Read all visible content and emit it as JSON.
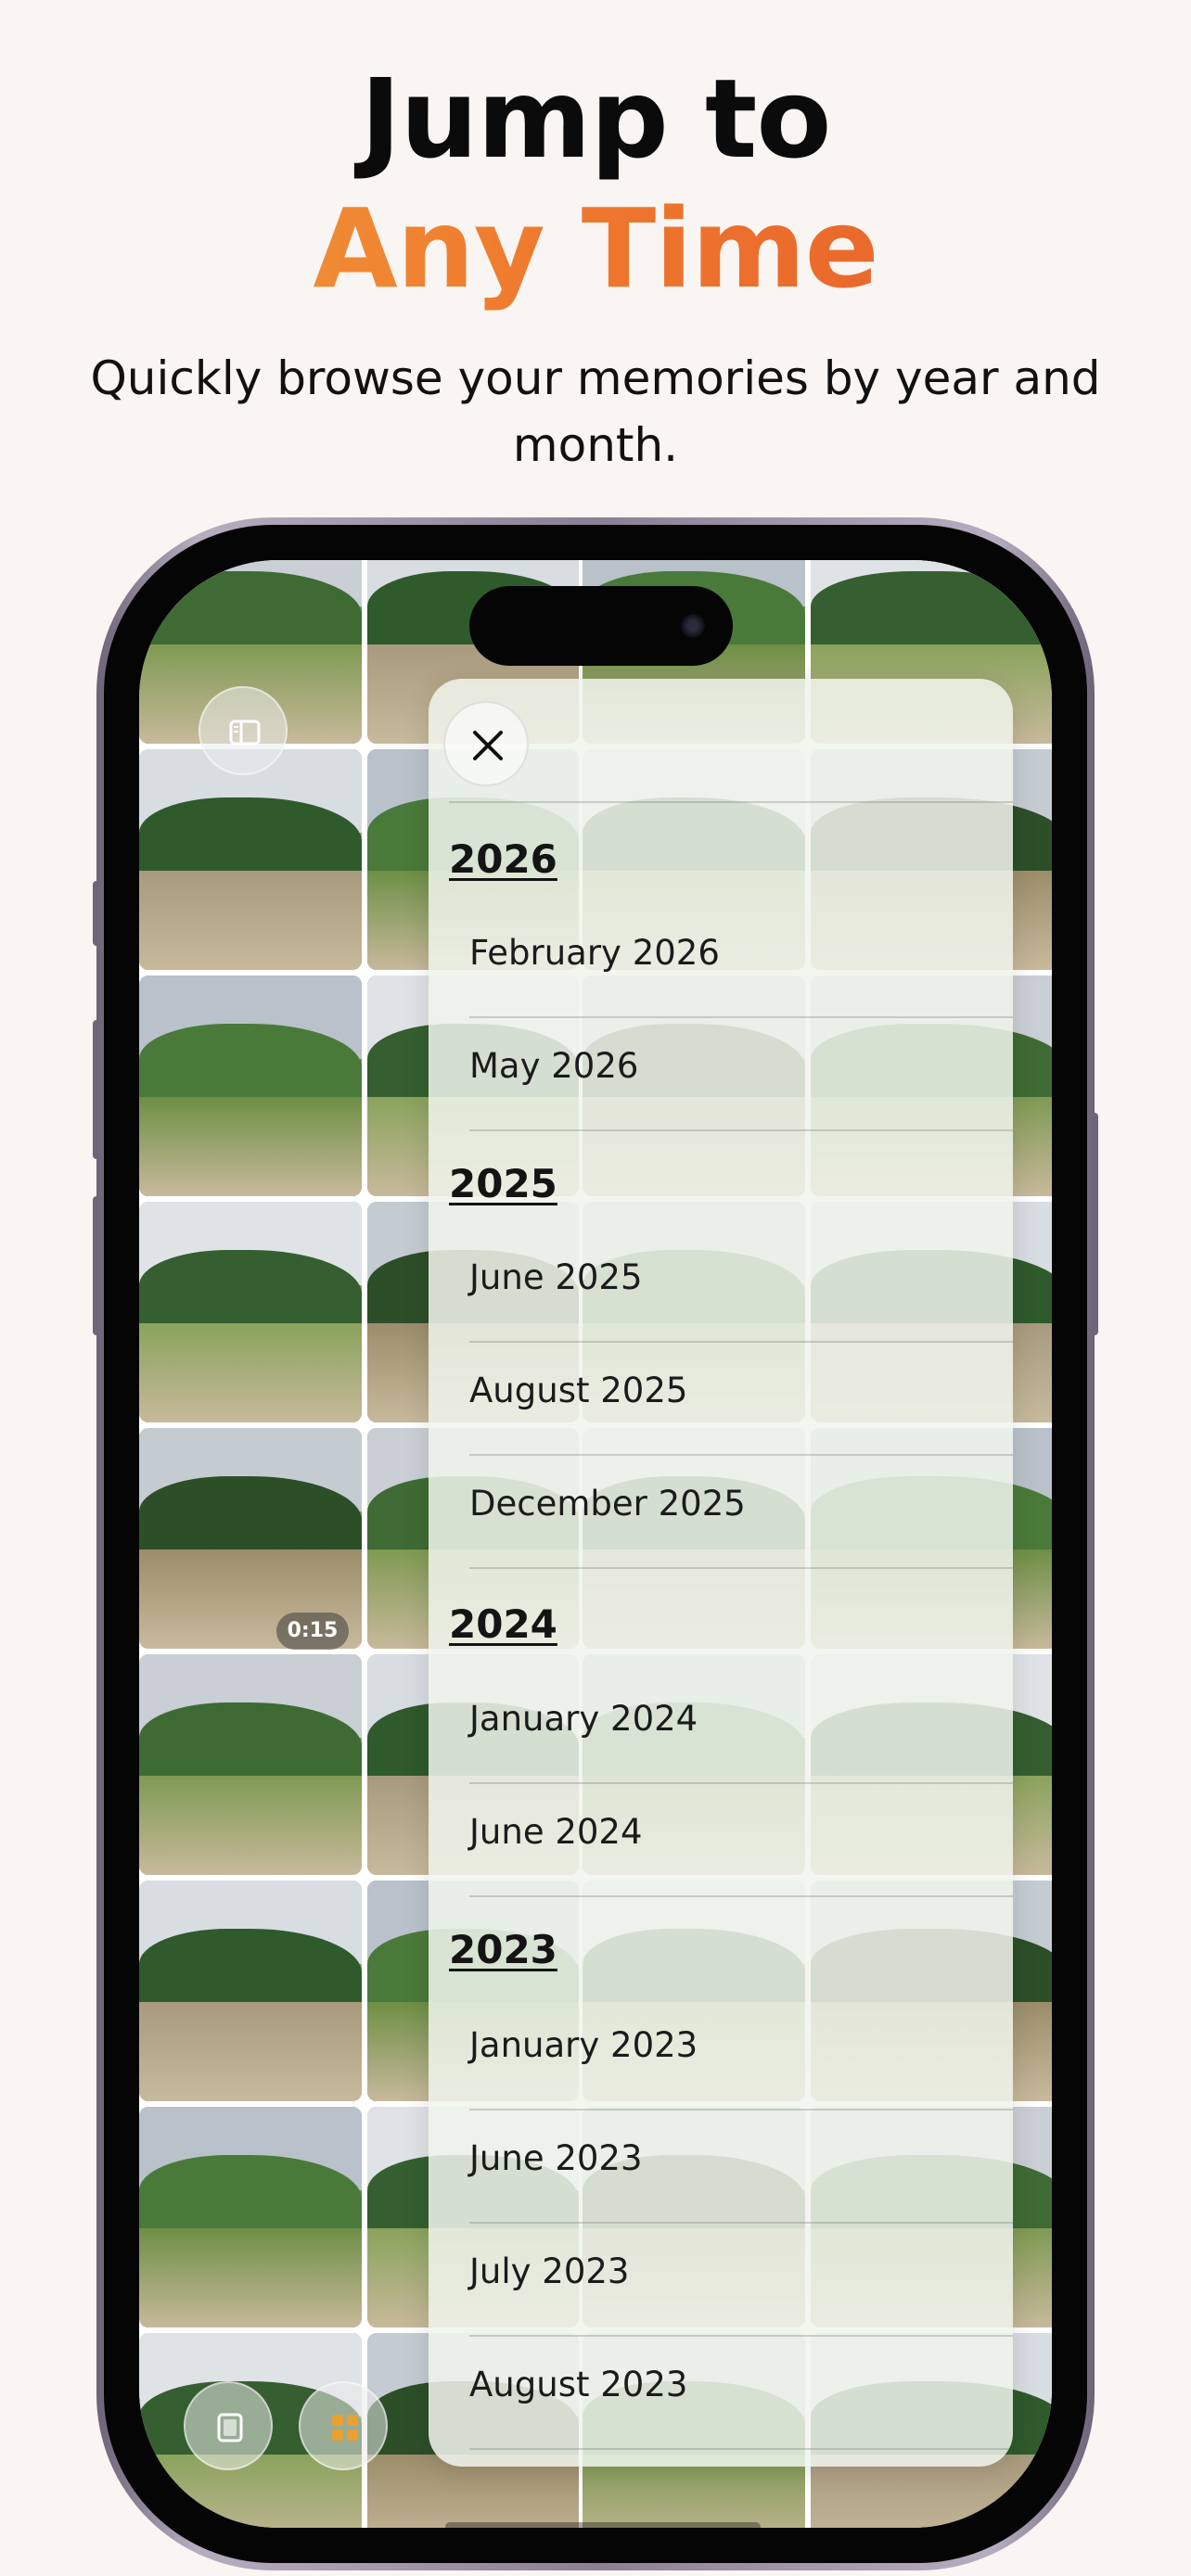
{
  "header": {
    "title_line1": "Jump to",
    "title_line2": "Any Time",
    "subtitle": "Quickly browse your memories by year and month."
  },
  "colors": {
    "background": "#f9f5f2",
    "accent_start": "#f3a23c",
    "accent_end": "#e5582a"
  },
  "photo_grid": {
    "video_duration": "0:15"
  },
  "picker": {
    "close_icon": "close-icon",
    "groups": [
      {
        "year": "2026",
        "months": [
          "February 2026",
          "May 2026"
        ]
      },
      {
        "year": "2025",
        "months": [
          "June 2025",
          "August 2025",
          "December 2025"
        ]
      },
      {
        "year": "2024",
        "months": [
          "January 2024",
          "June 2024"
        ]
      },
      {
        "year": "2023",
        "months": [
          "January 2023",
          "June 2023",
          "July 2023",
          "August 2023"
        ]
      }
    ]
  },
  "bottom_buttons": {
    "left_icon": "albums-icon",
    "right_icon": "grid-icon"
  },
  "top_button_icon": "sidebar-icon"
}
